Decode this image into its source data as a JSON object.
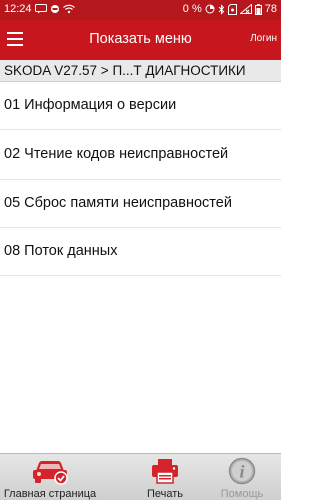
{
  "status_bar": {
    "time": "12:24",
    "battery_percent": "0 %",
    "battery_level": "78",
    "icons": [
      "message-icon",
      "notification-icon",
      "wifi-icon",
      "bluetooth-icon",
      "data-saver-icon",
      "sim-icon",
      "no-signal-icon",
      "battery-icon"
    ]
  },
  "app_bar": {
    "title": "Показать меню",
    "login_label": "Логин",
    "menu_icon": "hamburger-menu-icon"
  },
  "breadcrumb": "SKODA V27.57 > П...Т ДИАГНОСТИКИ",
  "menu": {
    "items": [
      {
        "label": "01 Информация о версии"
      },
      {
        "label": "02 Чтение кодов неисправностей"
      },
      {
        "label": "05 Сброс памяти неисправностей"
      },
      {
        "label": "08 Поток данных"
      }
    ]
  },
  "bottom_nav": {
    "items": [
      {
        "label": "Главная страница",
        "icon": "car-home-icon",
        "enabled": true
      },
      {
        "label": "Печать",
        "icon": "printer-icon",
        "enabled": true
      },
      {
        "label": "Помощь",
        "icon": "info-icon",
        "enabled": false
      }
    ]
  },
  "colors": {
    "app_bar": "#c8161e",
    "status_bar": "#b5171c",
    "accent": "#d3242b",
    "breadcrumb_bg": "#e9e9e9",
    "divider": "#e4e4e4",
    "bottom_nav_bg": "#dcdcdc",
    "disabled": "#9a9a9a"
  }
}
